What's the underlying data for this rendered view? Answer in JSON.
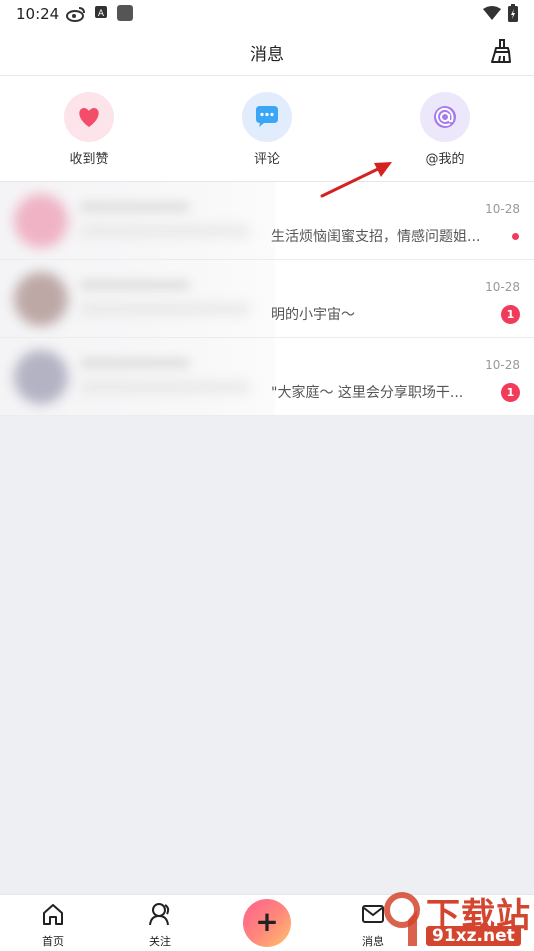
{
  "status": {
    "time": "10:24"
  },
  "header": {
    "title": "消息"
  },
  "categories": [
    {
      "label": "收到赞",
      "icon": "heart-icon",
      "bg": "#fde3ea",
      "color": "#f44d6a"
    },
    {
      "label": "评论",
      "icon": "comment-icon",
      "bg": "#e1edfc",
      "color": "#3aa6f5"
    },
    {
      "label": "@我的",
      "icon": "at-icon",
      "bg": "#ece7fb",
      "color": "#a57af0"
    }
  ],
  "messages": [
    {
      "preview": "生活烦恼闺蜜支招，情感问题姐...",
      "date": "10-28",
      "unread": "dot"
    },
    {
      "preview": "明的小宇宙～",
      "date": "10-28",
      "unread": "1"
    },
    {
      "preview": "\"大家庭～ 这里会分享职场干...",
      "date": "10-28",
      "unread": "1"
    }
  ],
  "nav": {
    "home": "首页",
    "follow": "关注",
    "post": "+",
    "messages": "消息"
  },
  "watermark": {
    "main": "下载站",
    "sub": "91xz.net"
  },
  "colors": {
    "accent": "#f03b5a",
    "arrow": "#d42222"
  }
}
